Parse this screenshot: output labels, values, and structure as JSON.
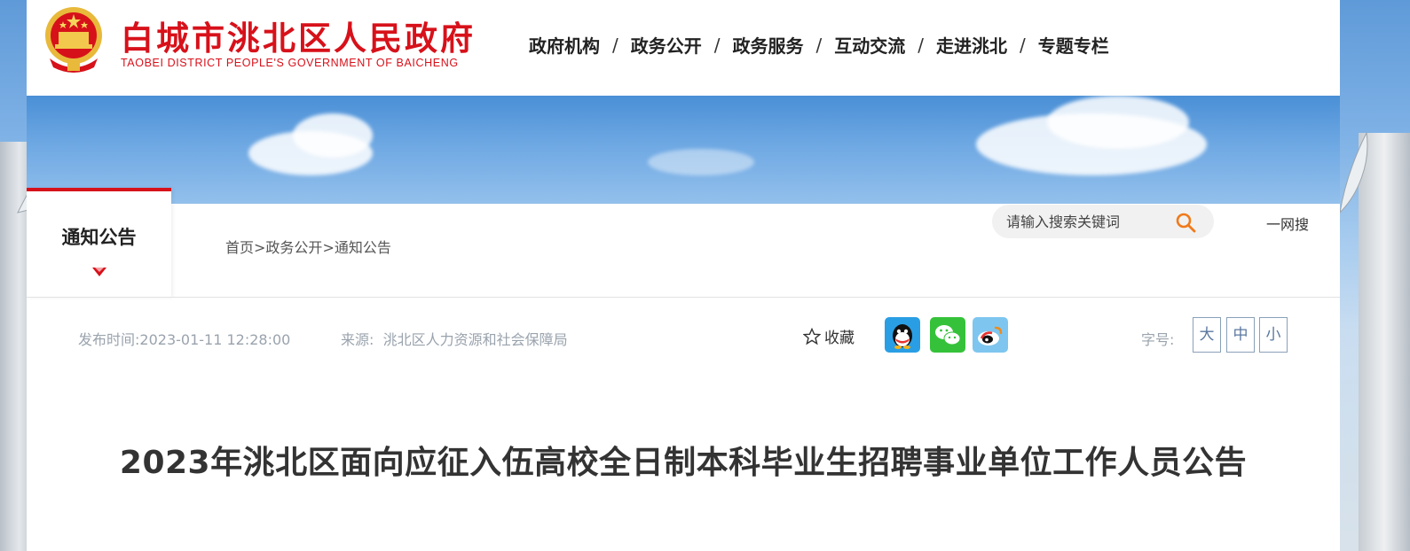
{
  "header": {
    "site_title": "白城市洮北区人民政府",
    "site_subtitle": "TAOBEI DISTRICT PEOPLE'S GOVERNMENT OF BAICHENG",
    "nav": [
      {
        "label": "政府机构"
      },
      {
        "label": "政务公开"
      },
      {
        "label": "政务服务"
      },
      {
        "label": "互动交流"
      },
      {
        "label": "走进洮北"
      },
      {
        "label": "专题专栏"
      }
    ],
    "nav_separator": "/"
  },
  "section": {
    "tab_label": "通知公告",
    "breadcrumb": [
      "首页",
      "政务公开",
      "通知公告"
    ],
    "breadcrumb_separator": ">"
  },
  "search": {
    "placeholder": "请输入搜索关键词",
    "global_label": "一网搜"
  },
  "article": {
    "publish_time_label": "发布时间:",
    "publish_time": "2023-01-11 12:28:00",
    "source_label": "来源:",
    "source": "洮北区人力资源和社会保障局",
    "favorite_label": "收藏",
    "font_size_label": "字号:",
    "font_sizes": [
      "大",
      "中",
      "小"
    ],
    "title": "2023年洮北区面向应征入伍高校全日制本科毕业生招聘事业单位工作人员公告"
  },
  "colors": {
    "brand_red": "#d7111a",
    "qq": "#2a9ee4",
    "wechat": "#35c23a",
    "weibo": "#7ec6ef"
  },
  "icons": {
    "emblem": "national-emblem-icon",
    "search": "search-icon",
    "favorite": "star-icon",
    "share": [
      "qq-icon",
      "wechat-icon",
      "weibo-icon"
    ]
  }
}
